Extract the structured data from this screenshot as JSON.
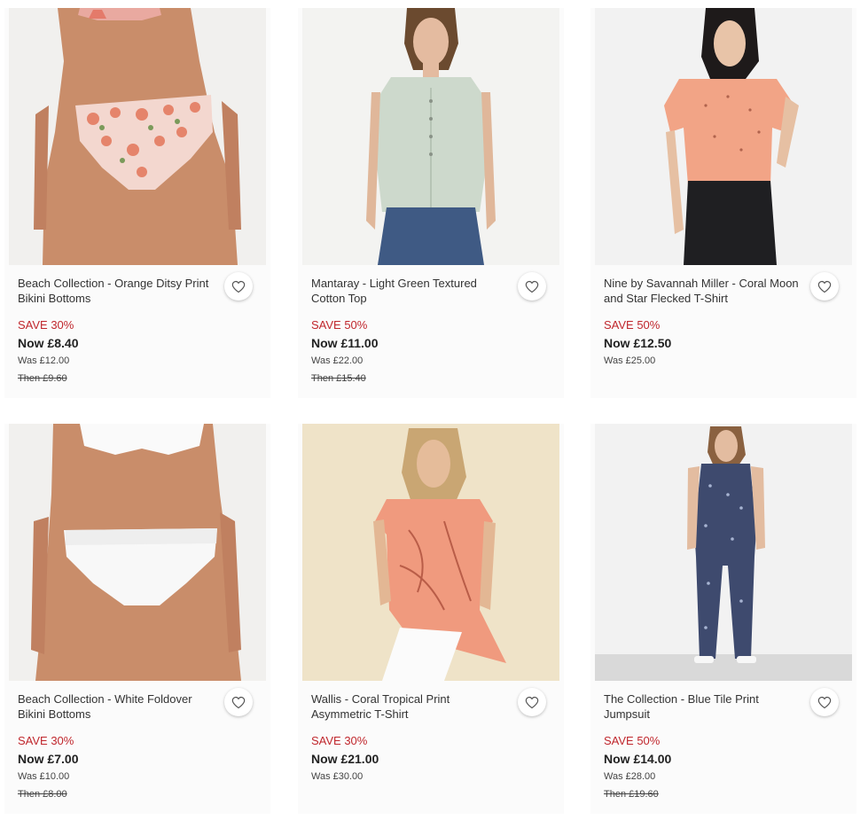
{
  "products": [
    {
      "title": "Beach Collection - Orange Ditsy Print Bikini Bottoms",
      "save": "SAVE 30%",
      "now": "Now £8.40",
      "was": "Was £12.00",
      "then": "Then £9.60",
      "image": "woman in orange floral print bikini bottoms"
    },
    {
      "title": "Mantaray - Light Green Textured Cotton Top",
      "save": "SAVE 50%",
      "now": "Now £11.00",
      "was": "Was £22.00",
      "then": "Then £15.40",
      "image": "woman in light green sleeveless cotton top and jeans"
    },
    {
      "title": "Nine by Savannah Miller - Coral Moon and Star Flecked T-Shirt",
      "save": "SAVE 50%",
      "now": "Now £12.50",
      "was": "Was £25.00",
      "then": "",
      "image": "woman in coral t-shirt and black jeans"
    },
    {
      "title": "Beach Collection - White Foldover Bikini Bottoms",
      "save": "SAVE 30%",
      "now": "Now £7.00",
      "was": "Was £10.00",
      "then": "Then £8.00",
      "image": "woman in white foldover bikini"
    },
    {
      "title": "Wallis - Coral Tropical Print Asymmetric T-Shirt",
      "save": "SAVE 30%",
      "now": "Now £21.00",
      "was": "Was £30.00",
      "then": "",
      "image": "woman in coral tropical print asymmetric t-shirt"
    },
    {
      "title": "The Collection - Blue Tile Print Jumpsuit",
      "save": "SAVE 50%",
      "now": "Now £14.00",
      "was": "Was £28.00",
      "then": "Then £19.60",
      "image": "woman in blue tile print jumpsuit"
    }
  ],
  "icons": {
    "wishlist": "heart-icon"
  },
  "colors": {
    "save": "#c0272d",
    "card_bg": "#fbfbfb"
  }
}
